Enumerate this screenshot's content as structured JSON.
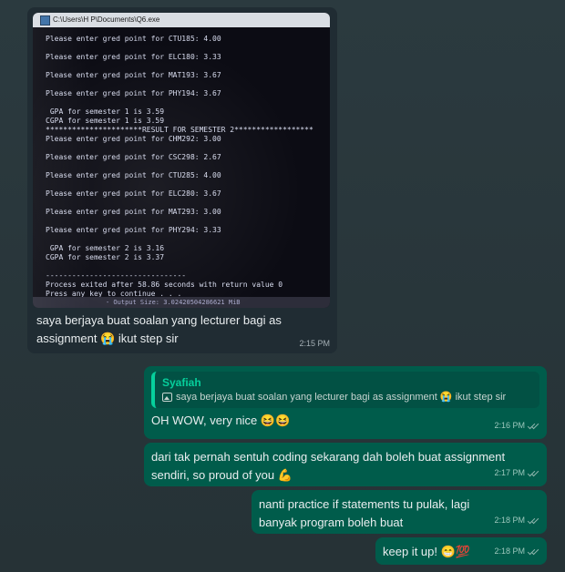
{
  "incoming": {
    "console": {
      "title": "C:\\Users\\H P\\Documents\\Q6.exe",
      "lines": [
        "Please enter gred point for CTU185: 4.00",
        "Please enter gred point for ELC180: 3.33",
        "Please enter gred point for MAT193: 3.67",
        "Please enter gred point for PHY194: 3.67",
        " GPA for semester 1 is 3.59",
        "CGPA for semester 1 is 3.59",
        "**********************RESULT FOR SEMESTER 2******************",
        "Please enter gred point for CHM292: 3.00",
        "Please enter gred point for CSC298: 2.67",
        "Please enter gred point for CTU285: 4.00",
        "Please enter gred point for ELC280: 3.67",
        "Please enter gred point for MAT293: 3.00",
        "Please enter gred point for PHY294: 3.33",
        " GPA for semester 2 is 3.16",
        "CGPA for semester 2 is 3.37",
        "--------------------------------",
        "Process exited after 58.86 seconds with return value 0",
        "Press any key to continue . . ."
      ],
      "status": "- Output Size: 3.02420504286621 MiB"
    },
    "caption": "saya berjaya buat soalan yang lecturer bagi as assignment 😭 ikut step sir",
    "time": "2:15 PM"
  },
  "outgoing": [
    {
      "quote_name": "Syafiah",
      "quote_text": "saya berjaya buat soalan yang lecturer bagi as assignment 😭 ikut step sir",
      "text": "OH WOW, very nice 😆😆",
      "time": "2:16 PM"
    },
    {
      "text": "dari tak pernah sentuh coding sekarang dah boleh buat assignment sendiri, so proud of you 💪",
      "time": "2:17 PM"
    },
    {
      "text": "nanti practice if statements tu pulak, lagi banyak program boleh buat",
      "time": "2:18 PM"
    },
    {
      "text": "keep it up! 😁💯",
      "time": "2:18 PM"
    }
  ],
  "colors": {
    "background": "#2b3a3f",
    "incoming_bubble": "#202c33",
    "outgoing_bubble": "#005c4b",
    "quote_accent": "#06cf9c"
  },
  "icons": [
    "exe-icon",
    "image-icon",
    "double-check-icon"
  ]
}
